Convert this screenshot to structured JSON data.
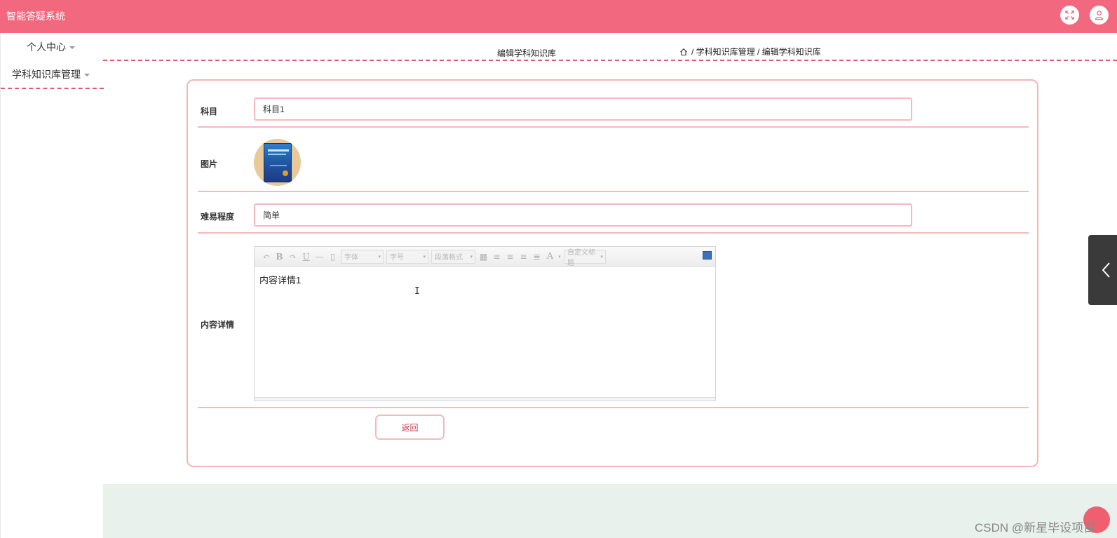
{
  "header": {
    "app_title": "智能答疑系统",
    "fullscreen_icon": "fullscreen-icon",
    "user_icon": "user-icon"
  },
  "sidebar": {
    "items": [
      {
        "label": "个人中心"
      },
      {
        "label": "学科知识库管理"
      }
    ]
  },
  "breadcrumb": {
    "page_title": "编辑学科知识库",
    "home_icon": "home-icon",
    "path": "/ 学科知识库管理 / 编辑学科知识库"
  },
  "form": {
    "subject": {
      "label": "科目",
      "value": "科目1"
    },
    "image": {
      "label": "图片"
    },
    "difficulty": {
      "label": "难易程度",
      "value": "简单"
    },
    "content": {
      "label": "内容详情",
      "value": "内容详情1",
      "toolbar": {
        "font_family": "字体",
        "font_size": "字号",
        "paragraph": "段落格式",
        "custom_title": "自定义标题"
      }
    },
    "back_label": "返回"
  },
  "watermark": "CSDN @新星毕设项目"
}
